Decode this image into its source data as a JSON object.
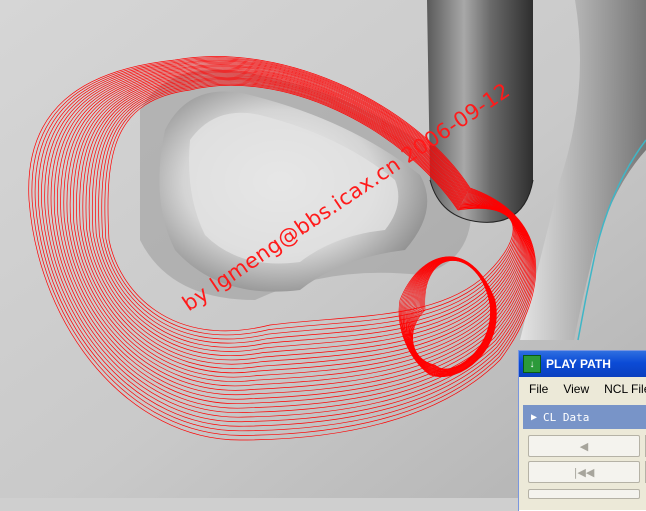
{
  "watermark": {
    "text": "by lgmeng@bbs.icax.cn 2006-09-12"
  },
  "panel": {
    "title": "PLAY PATH",
    "menu": [
      "File",
      "View",
      "NCL File"
    ],
    "tree_item": "CL Data",
    "buttons": {
      "step_back_icon": "step-back-icon",
      "rewind_icon": "rewind-icon"
    }
  },
  "colors": {
    "toolpath": "#ff0000",
    "accent": "#0a4bd6"
  }
}
